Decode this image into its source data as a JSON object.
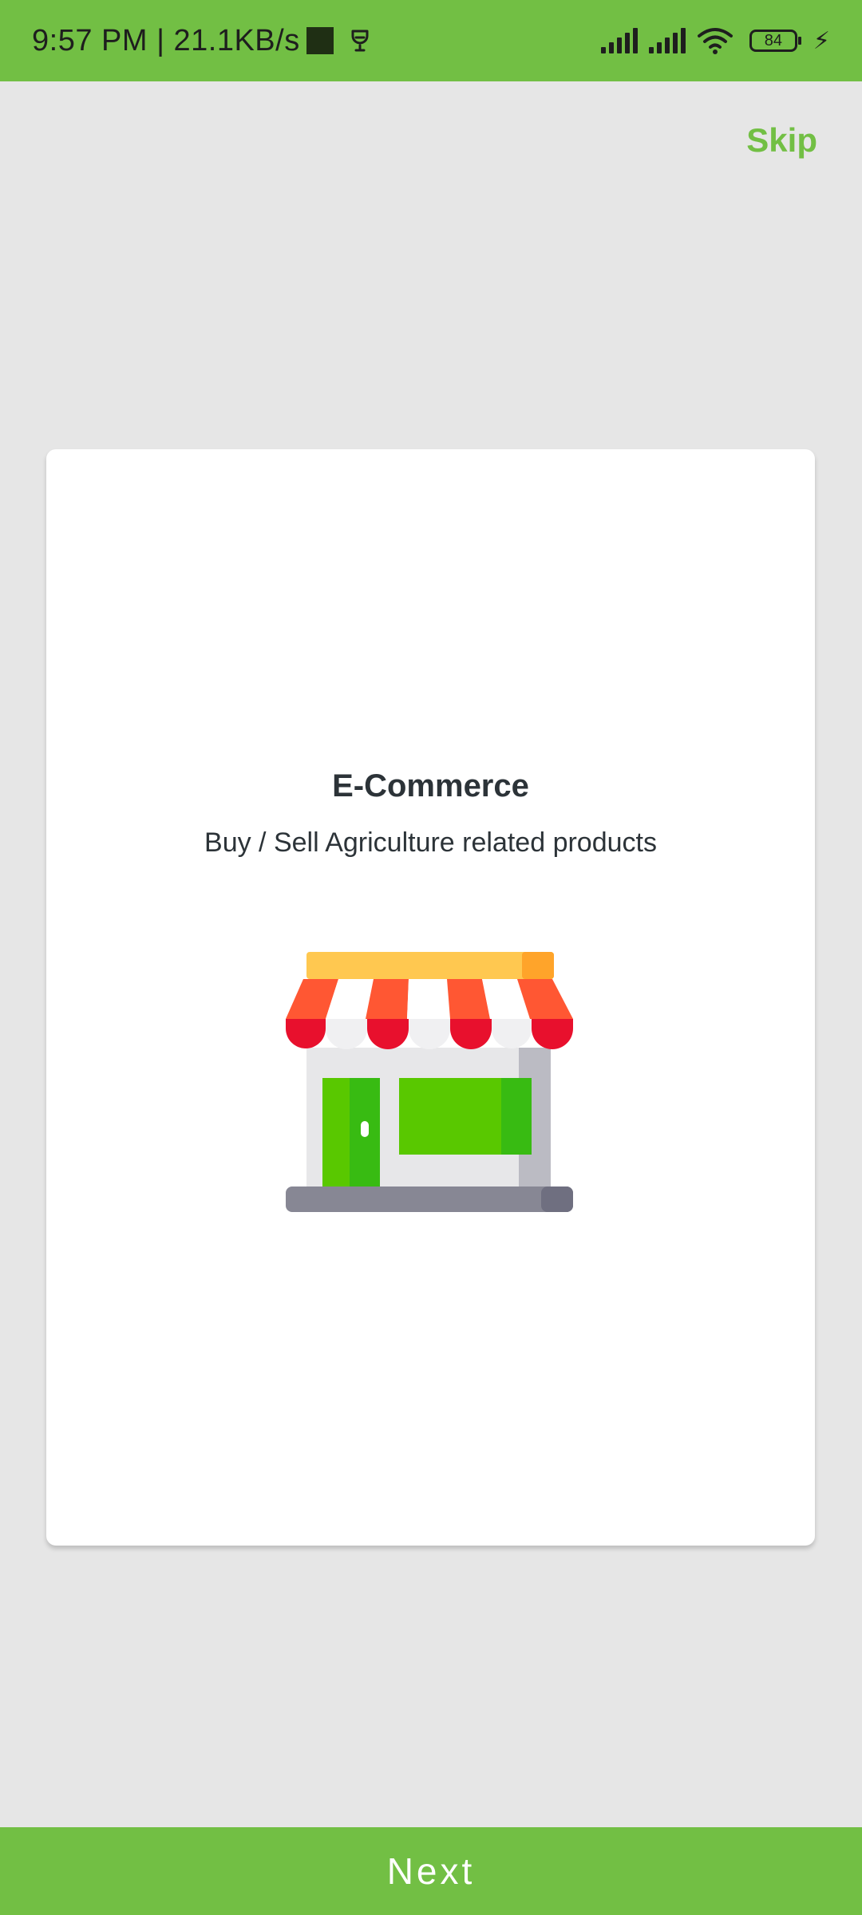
{
  "status_bar": {
    "time_speed": "9:57 PM | 21.1KB/s",
    "battery_level": "84",
    "bar_color": "#72bf44"
  },
  "skip_label": "Skip",
  "card": {
    "title": "E-Commerce",
    "subtitle": "Buy / Sell Agriculture related products",
    "illustration_icon": "storefront-icon"
  },
  "next_label": "Next",
  "colors": {
    "accent": "#72bf44",
    "background": "#e6e6e6",
    "card": "#ffffff",
    "text": "#2c3338"
  }
}
